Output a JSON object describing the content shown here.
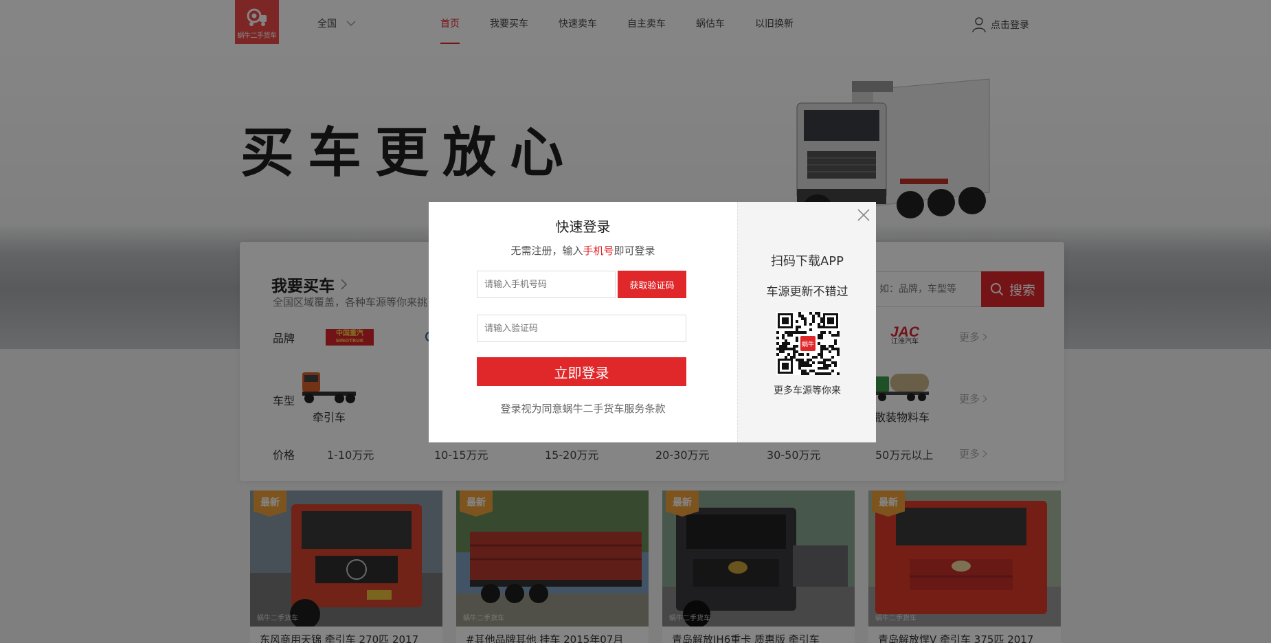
{
  "header": {
    "logo_text": "蜗牛二手货车",
    "region": "全国",
    "nav": [
      "首页",
      "我要买车",
      "快速卖车",
      "自主卖车",
      "蜗估车",
      "以旧换新"
    ],
    "active_nav": "首页",
    "login": "点击登录"
  },
  "hero": {
    "slogan": "买车更放心"
  },
  "panel": {
    "title": "我要买车",
    "subtitle": "全国区域覆盖，各种车源等你来挑",
    "search_placeholder": "如：品牌，车型等",
    "search_button": "搜索",
    "brand_label": "品牌",
    "type_label": "车型",
    "price_label": "价格",
    "more": "更多",
    "brands": [
      "中国重汽",
      "SINOTRUK",
      "JAC",
      "江淮汽车"
    ],
    "types": [
      "牵引车",
      "散装物料车"
    ],
    "prices": [
      "1-10万元",
      "10-15万元",
      "15-20万元",
      "20-30万元",
      "30-50万元",
      "50万元以上"
    ]
  },
  "cards": [
    {
      "badge": "最新",
      "title": "东风商用天锦 牵引车 270匹 2017",
      "color": "#d9432c"
    },
    {
      "badge": "最新",
      "title": "#其他品牌其他 挂车 2015年07月",
      "color": "#b83a30"
    },
    {
      "badge": "最新",
      "title": "青岛解放JH6重卡 质惠版 牵引车",
      "color": "#3a3a40"
    },
    {
      "badge": "最新",
      "title": "青岛解放悍V 牵引车 375匹 2017",
      "color": "#e03a2a"
    }
  ],
  "watermark": "蜗牛二手货车",
  "modal": {
    "title": "快速登录",
    "subtitle_prefix": "无需注册，输入",
    "subtitle_highlight": "手机号",
    "subtitle_suffix": "即可登录",
    "phone_placeholder": "请输入手机号码",
    "code_button": "获取验证码",
    "code_placeholder": "请输入验证码",
    "login_button": "立即登录",
    "terms": "登录视为同意蜗牛二手货车服务条款",
    "app_title": "扫码下载APP",
    "app_subtitle": "车源更新不错过",
    "qr_caption": "更多车源等你来",
    "qr_center": "蜗牛"
  },
  "colors": {
    "brand_red": "#e0282b",
    "badge_orange": "#f0a23b"
  }
}
